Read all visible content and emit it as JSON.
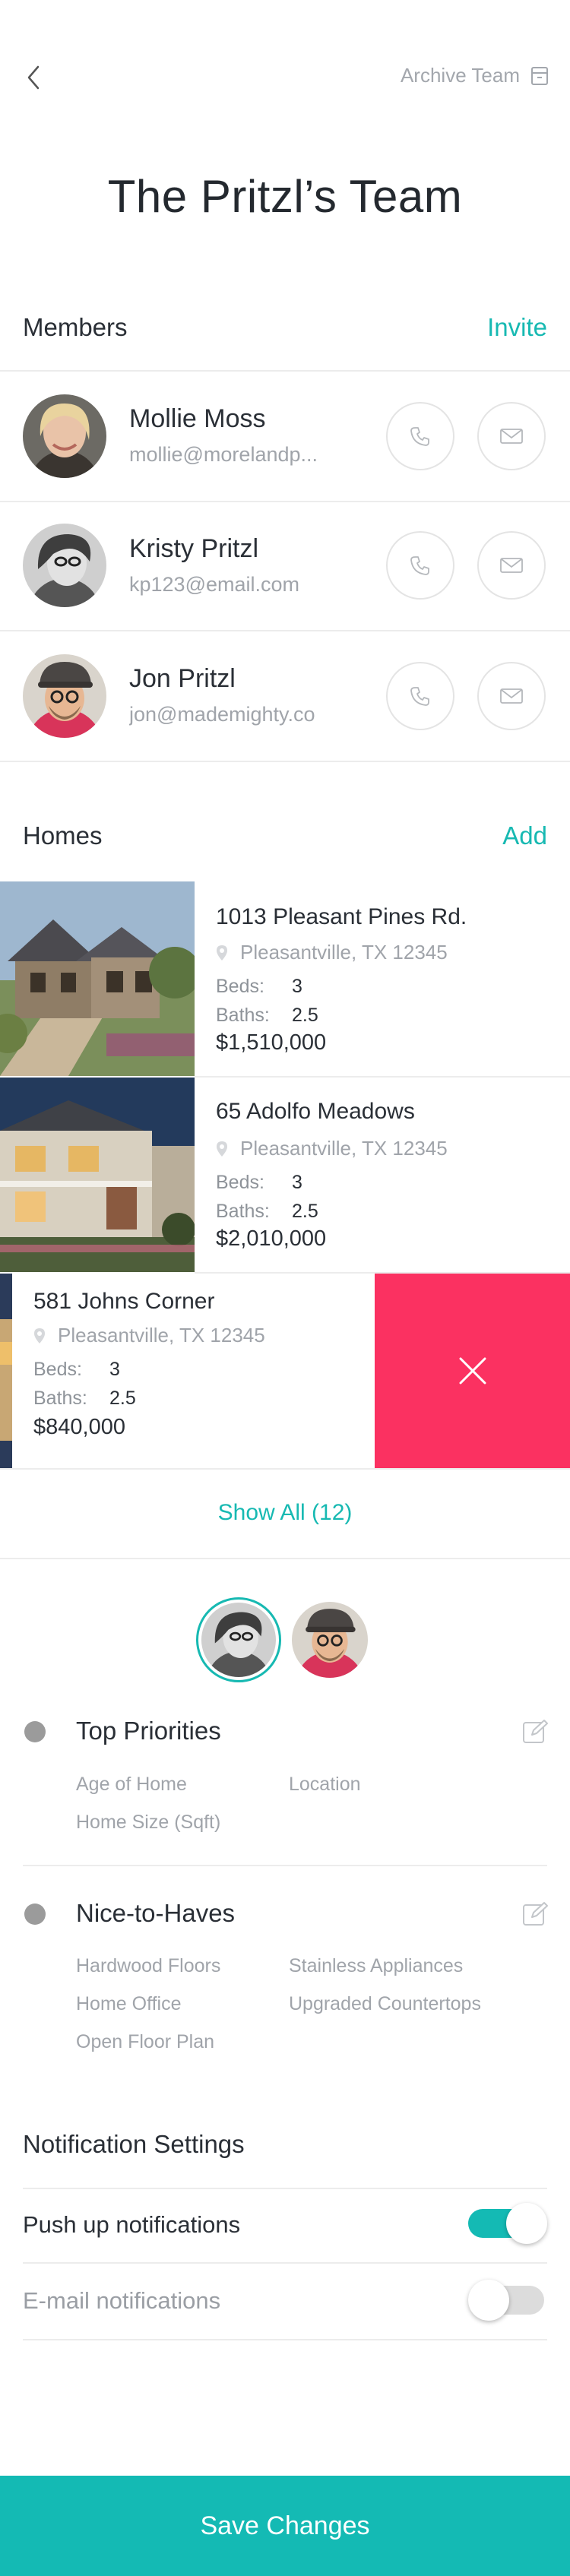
{
  "header": {
    "archive_label": "Archive Team",
    "team_title": "The Pritzl’s Team"
  },
  "members_section": {
    "title": "Members",
    "action_label": "Invite",
    "members": [
      {
        "name": "Mollie Moss",
        "email": "mollie@morelandp..."
      },
      {
        "name": "Kristy Pritzl",
        "email": "kp123@email.com"
      },
      {
        "name": "Jon Pritzl",
        "email": "jon@mademighty.co"
      }
    ]
  },
  "homes_section": {
    "title": "Homes",
    "action_label": "Add",
    "beds_label": "Beds:",
    "baths_label": "Baths:",
    "homes": [
      {
        "address": "1013 Pleasant Pines Rd.",
        "city": "Pleasantville, TX 12345",
        "beds": "3",
        "baths": "2.5",
        "price": "$1,510,000"
      },
      {
        "address": "65 Adolfo Meadows",
        "city": "Pleasantville, TX 12345",
        "beds": "3",
        "baths": "2.5",
        "price": "$2,010,000"
      },
      {
        "address": "581 Johns Corner",
        "city": "Pleasantville, TX 12345",
        "beds": "3",
        "baths": "2.5",
        "price": "$840,000"
      }
    ],
    "show_all_label": "Show All (12)"
  },
  "priorities": {
    "top": {
      "title": "Top Priorities",
      "items": [
        "Age of Home",
        "Location",
        "Home Size (Sqft)"
      ]
    },
    "nice": {
      "title": "Nice-to-Haves",
      "items": [
        "Hardwood Floors",
        "Stainless Appliances",
        "Home Office",
        "Upgraded Countertops",
        "Open Floor Plan"
      ]
    }
  },
  "notifications": {
    "title": "Notification Settings",
    "push_label": "Push up notifications",
    "push_enabled": true,
    "email_label": "E-mail notifications",
    "email_enabled": false
  },
  "footer": {
    "save_label": "Save Changes"
  },
  "colors": {
    "accent": "#17b9b2",
    "delete": "#fb3161",
    "save_bar": "#14bab4"
  }
}
